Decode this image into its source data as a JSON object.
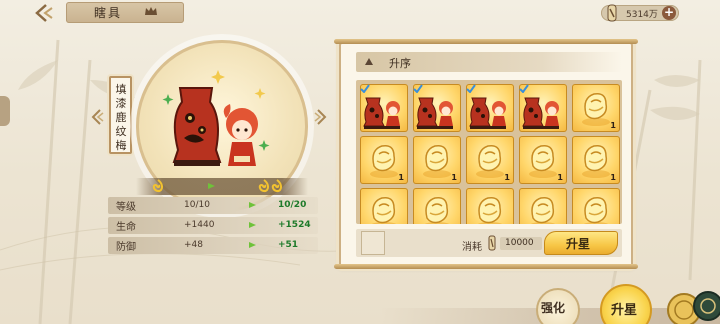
{
  "header": {
    "title": "瞎具",
    "currency": {
      "icon": "scroll-coin-icon",
      "amount": "5314万",
      "add_label": "+"
    }
  },
  "item": {
    "name_chars": [
      "填",
      "漆",
      "鹿",
      "纹",
      "梅"
    ],
    "star_current": 1,
    "star_next": 2
  },
  "stats": [
    {
      "label": "等级",
      "current": "10/10",
      "next": "10/20"
    },
    {
      "label": "生命",
      "current": "+1440",
      "next": "+1524"
    },
    {
      "label": "防御",
      "current": "+48",
      "next": "+51"
    }
  ],
  "upgrade_panel": {
    "section_label": "升序",
    "materials": [
      {
        "kind": "vase-character",
        "count": "",
        "checked": true
      },
      {
        "kind": "vase-character",
        "count": "",
        "checked": true
      },
      {
        "kind": "vase-character",
        "count": "",
        "checked": true
      },
      {
        "kind": "vase-character",
        "count": "",
        "checked": true
      },
      {
        "kind": "gold-ingot",
        "count": "1",
        "checked": false
      },
      {
        "kind": "gold-ingot",
        "count": "1",
        "checked": false
      },
      {
        "kind": "gold-ingot",
        "count": "1",
        "checked": false
      },
      {
        "kind": "gold-ingot",
        "count": "1",
        "checked": false
      },
      {
        "kind": "gold-ingot",
        "count": "1",
        "checked": false
      },
      {
        "kind": "gold-ingot",
        "count": "1",
        "checked": false
      },
      {
        "kind": "gold-ingot",
        "count": "",
        "checked": false
      },
      {
        "kind": "gold-ingot",
        "count": "",
        "checked": false
      },
      {
        "kind": "gold-ingot",
        "count": "",
        "checked": false
      },
      {
        "kind": "gold-ingot",
        "count": "",
        "checked": false
      },
      {
        "kind": "gold-ingot",
        "count": "",
        "checked": false
      }
    ],
    "cost_label": "消耗",
    "cost_value": "10000",
    "confirm_label": "升星"
  },
  "bottom_buttons": {
    "strengthen_label": "强化",
    "upstar_label": "升星"
  },
  "colors": {
    "accent_gold": "#f7c646",
    "stat_green": "#1e7a2a",
    "frame_brown": "#cdb084"
  }
}
